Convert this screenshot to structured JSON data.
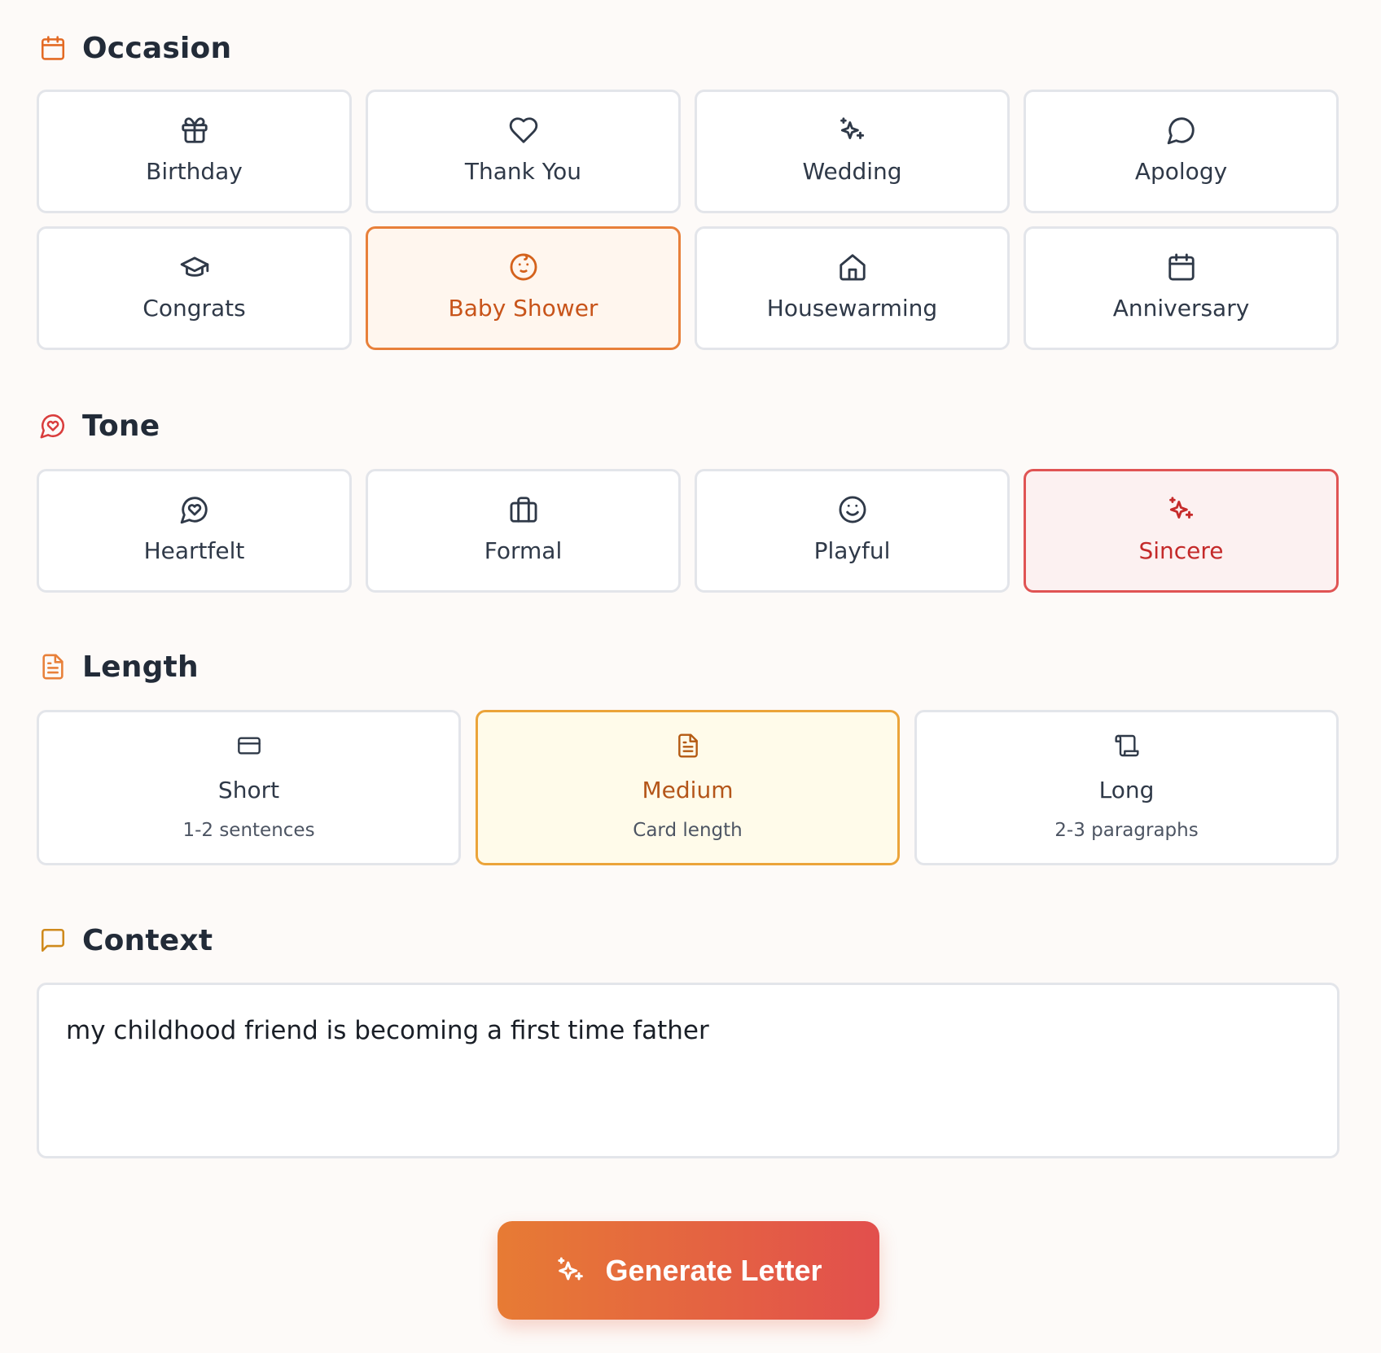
{
  "occasion": {
    "heading": "Occasion",
    "options": [
      {
        "label": "Birthday",
        "icon": "gift-icon"
      },
      {
        "label": "Thank You",
        "icon": "heart-icon"
      },
      {
        "label": "Wedding",
        "icon": "sparkles-icon"
      },
      {
        "label": "Apology",
        "icon": "message-circle-icon"
      },
      {
        "label": "Congrats",
        "icon": "graduation-cap-icon"
      },
      {
        "label": "Baby Shower",
        "icon": "baby-face-icon"
      },
      {
        "label": "Housewarming",
        "icon": "house-icon"
      },
      {
        "label": "Anniversary",
        "icon": "calendar-icon"
      }
    ],
    "selected": "Baby Shower"
  },
  "tone": {
    "heading": "Tone",
    "options": [
      {
        "label": "Heartfelt",
        "icon": "message-heart-icon"
      },
      {
        "label": "Formal",
        "icon": "briefcase-icon"
      },
      {
        "label": "Playful",
        "icon": "smile-icon"
      },
      {
        "label": "Sincere",
        "icon": "sparkles-icon"
      }
    ],
    "selected": "Sincere"
  },
  "length": {
    "heading": "Length",
    "options": [
      {
        "label": "Short",
        "sub": "1-2 sentences",
        "icon": "card-icon"
      },
      {
        "label": "Medium",
        "sub": "Card length",
        "icon": "document-icon"
      },
      {
        "label": "Long",
        "sub": "2-3 paragraphs",
        "icon": "scroll-icon"
      }
    ],
    "selected": "Medium"
  },
  "context": {
    "heading": "Context",
    "value": "my childhood friend is becoming a first time father"
  },
  "generate_button": {
    "label": "Generate Letter",
    "icon": "sparkles-icon"
  },
  "colors": {
    "accent_orange": "#e8803a",
    "accent_red": "#e05454",
    "accent_amber": "#eba43a"
  }
}
